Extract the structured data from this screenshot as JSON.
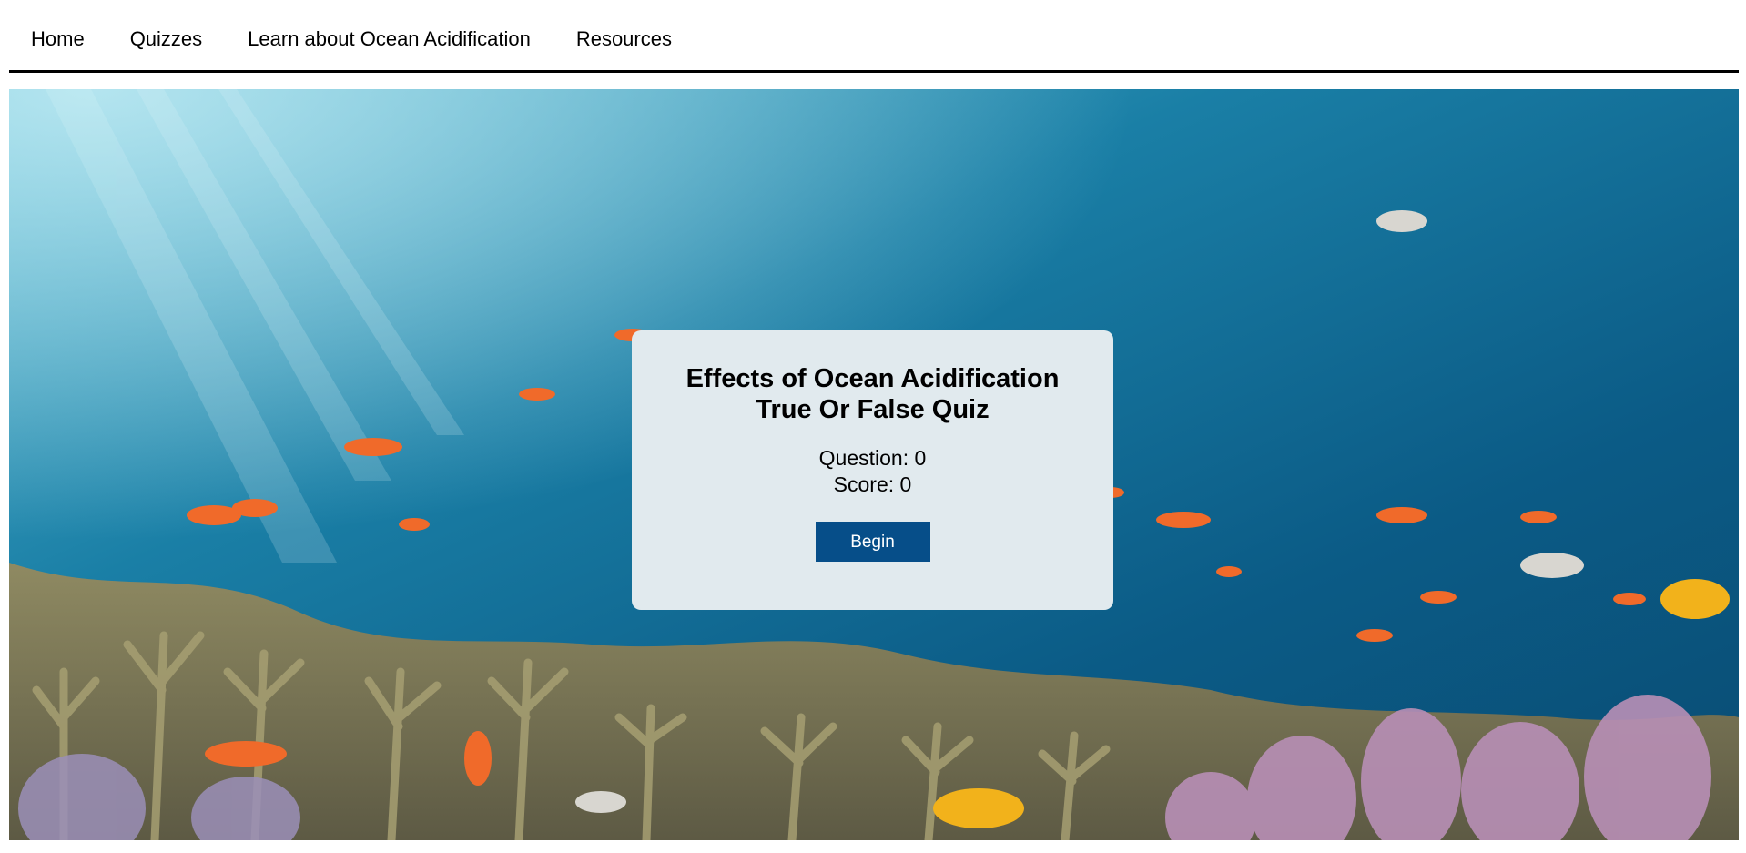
{
  "nav": {
    "items": [
      {
        "label": "Home"
      },
      {
        "label": "Quizzes"
      },
      {
        "label": "Learn about Ocean Acidification"
      },
      {
        "label": "Resources"
      }
    ]
  },
  "hero": {
    "image_subject": "underwater coral reef with tropical fish",
    "colors": {
      "water_light": "#3fa7c4",
      "water_dark": "#0b4f78",
      "coral": "#8a8a5c",
      "fish": "#f06a2a"
    }
  },
  "quiz": {
    "title_line1": "Effects of Ocean Acidification",
    "title_line2": "True Or False Quiz",
    "question_label": "Question: 0",
    "score_label": "Score: 0",
    "begin_label": "Begin",
    "button_color": "#064e89",
    "card_color": "#e1eaee"
  }
}
